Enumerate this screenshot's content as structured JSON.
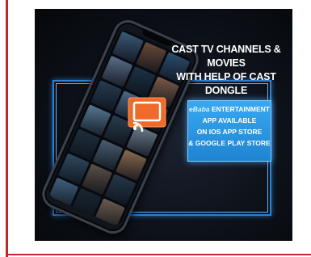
{
  "colors": {
    "rule": "#c0272d",
    "frame_blue": "#2d7fd4",
    "info_box": "#2b96e2",
    "cast_orange": "#f06a2a"
  },
  "headline": {
    "line1": "CAST TV CHANNELS & MOVIES",
    "line2": "WITH HELP OF CAST DONGLE"
  },
  "info": {
    "brand": "eBaba",
    "line1_rest": " ENTERTAINMENT",
    "line2": "APP AVAILABLE",
    "line3": "ON IOS APP STORE",
    "line4": "& GOOGLE PLAY STORE"
  },
  "icons": {
    "cast": "cast-icon",
    "phone": "smartphone-icon"
  },
  "tiles": [
    "#3b5a78",
    "#6a4a3a",
    "#2c4e6e",
    "#5a6f88",
    "#1d3346",
    "#7a5a48",
    "#263c52",
    "#4b6a86",
    "#3a2a26",
    "#567894",
    "#2a3d4e",
    "#6e7f8f",
    "#1f2f3f",
    "#4a5e70",
    "#8a6a50",
    "#304a62",
    "#5d5048",
    "#27394a",
    "#40607c",
    "#1a2633",
    "#6b5c4f"
  ]
}
